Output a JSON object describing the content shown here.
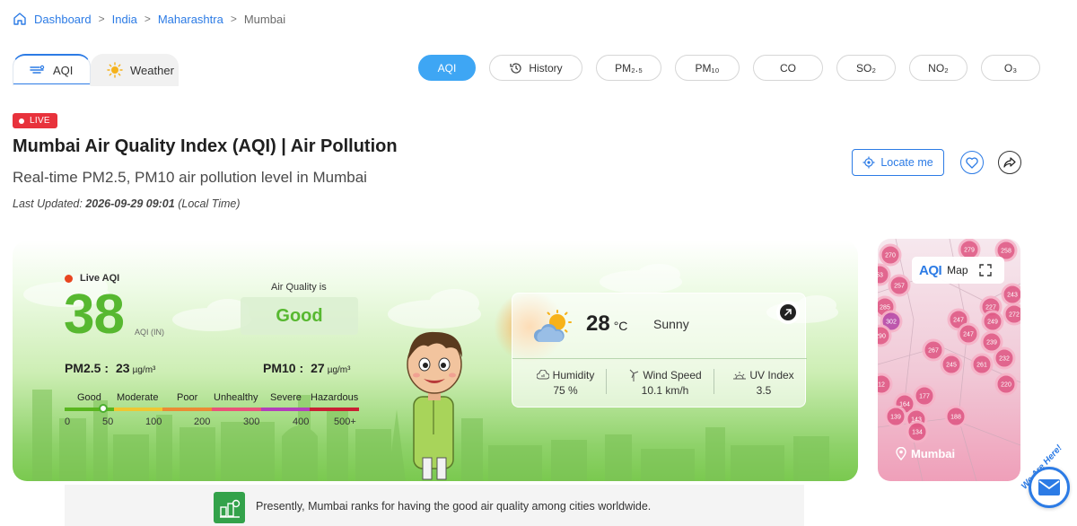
{
  "breadcrumb": {
    "items": [
      "Dashboard",
      "India",
      "Maharashtra",
      "Mumbai"
    ]
  },
  "main_tabs": [
    {
      "label": "AQI",
      "icon": "wind-icon",
      "active": true
    },
    {
      "label": "Weather",
      "icon": "sun-icon",
      "active": false
    }
  ],
  "pollutant_tabs": [
    {
      "label": "AQI",
      "active": true
    },
    {
      "label": "History",
      "icon": "history-icon",
      "active": false
    },
    {
      "label": "PM₂.₅",
      "active": false
    },
    {
      "label": "PM₁₀",
      "active": false
    },
    {
      "label": "CO",
      "active": false
    },
    {
      "label": "SO₂",
      "active": false
    },
    {
      "label": "NO₂",
      "active": false
    },
    {
      "label": "O₃",
      "active": false
    }
  ],
  "header": {
    "live_badge": "LIVE",
    "title": "Mumbai Air Quality Index (AQI) | Air Pollution",
    "subtitle": "Real-time PM2.5, PM10 air pollution level in Mumbai",
    "last_updated_prefix": "Last Updated:",
    "last_updated_value": "2026-09-29 09:01",
    "last_updated_suffix": "(Local Time)",
    "locate_label": "Locate me"
  },
  "aqi": {
    "live_label": "Live AQI",
    "value": "38",
    "unit": "AQI (IN)",
    "status_label": "Air Quality is",
    "status": "Good",
    "pm25_label": "PM2.5 :",
    "pm25_value": "23",
    "pm25_unit": "µg/m³",
    "pm10_label": "PM10 :",
    "pm10_value": "27",
    "pm10_unit": "µg/m³",
    "scale_categories": [
      "Good",
      "Moderate",
      "Poor",
      "Unhealthy",
      "Severe",
      "Hazardous"
    ],
    "scale_numbers": [
      "0",
      "50",
      "100",
      "200",
      "300",
      "400",
      "500+"
    ],
    "scale_colors": [
      "#59b61f",
      "#eec732",
      "#ea8c34",
      "#e95478",
      "#b33fba",
      "#c92033"
    ],
    "accent_color": "#57b830"
  },
  "weather": {
    "temp": "28",
    "temp_unit": "°C",
    "condition": "Sunny",
    "humidity_label": "Humidity",
    "humidity_value": "75 %",
    "wind_label": "Wind Speed",
    "wind_value": "10.1 km/h",
    "uv_label": "UV Index",
    "uv_value": "3.5"
  },
  "map": {
    "logo": "AQI",
    "label": "Map",
    "city": "Mumbai",
    "markers": [
      "270",
      "279",
      "258",
      "53",
      "257",
      "243",
      "227",
      "285",
      "302",
      "249",
      "272",
      "247",
      "290",
      "247",
      "239",
      "267",
      "245",
      "232",
      "261",
      "220",
      "164",
      "177",
      "139",
      "143",
      "188",
      "134",
      "12"
    ]
  },
  "ranking": {
    "text": "Presently, Mumbai ranks for having the good air quality among cities worldwide."
  },
  "chat": {
    "label": "We Are Here!"
  }
}
